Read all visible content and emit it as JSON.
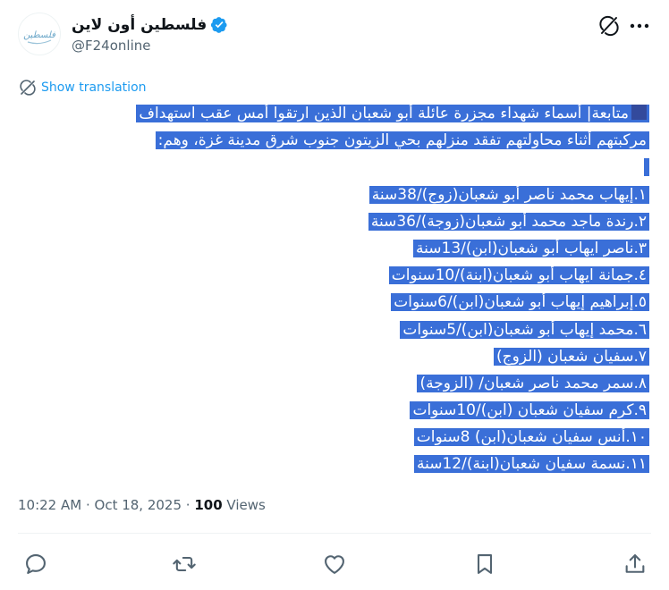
{
  "author": {
    "display_name": "فلسطين أون لاين",
    "handle": "@F24online",
    "avatar_label": "فلسطين",
    "verified": true
  },
  "translate": {
    "label": "Show translation"
  },
  "tweet": {
    "lines": [
      "متابعة| أسماء شهداء مجزرة عائلة أبو شعبان الذين ارتقوا أمس عقب استهداف",
      "مركبتهم أثناء محاولتهم تفقد منزلهم بحي الزيتون جنوب شرق مدينة غزة، وهم:",
      " ",
      "١.إيهاب محمد ناصر أبو شعبان(زوج)/38سنة",
      "٢.رندة ماجد محمد أبو شعبان(زوجة)/36سنة",
      "٣.ناصر ايهاب أبو شعبان(ابن)/13سنة",
      "٤.جمانة ايهاب أبو شعبان(ابنة)/10سنوات",
      "٥.إبراهيم إيهاب أبو شعبان(ابن)/6سنوات",
      "٦.محمد إيهاب أبو شعبان(ابن)/5سنوات",
      "٧.سفيان شعبان (الزوج)",
      "٨.سمر محمد ناصر شعبان/ (الزوجة)",
      "٩.كرم سفيان شعبان  (ابن)/10سنوات",
      "١٠.أنس سفيان شعبان(ابن) 8سنوات",
      "١١.نسمة سفيان شعبان(ابنة)/12سنة"
    ]
  },
  "meta": {
    "time": "10:22 AM",
    "separator": " · ",
    "date": "Oct 18, 2025",
    "views_count": "100",
    "views_label": "Views"
  },
  "colors": {
    "highlight": "#3a6fd8",
    "link": "#1d9bf0",
    "secondary_text": "#536471",
    "verified": "#1d9bf0"
  },
  "icons": [
    "grok-icon",
    "more-icon",
    "translate-icon",
    "reply-icon",
    "repost-icon",
    "like-icon",
    "bookmark-icon",
    "share-icon"
  ]
}
